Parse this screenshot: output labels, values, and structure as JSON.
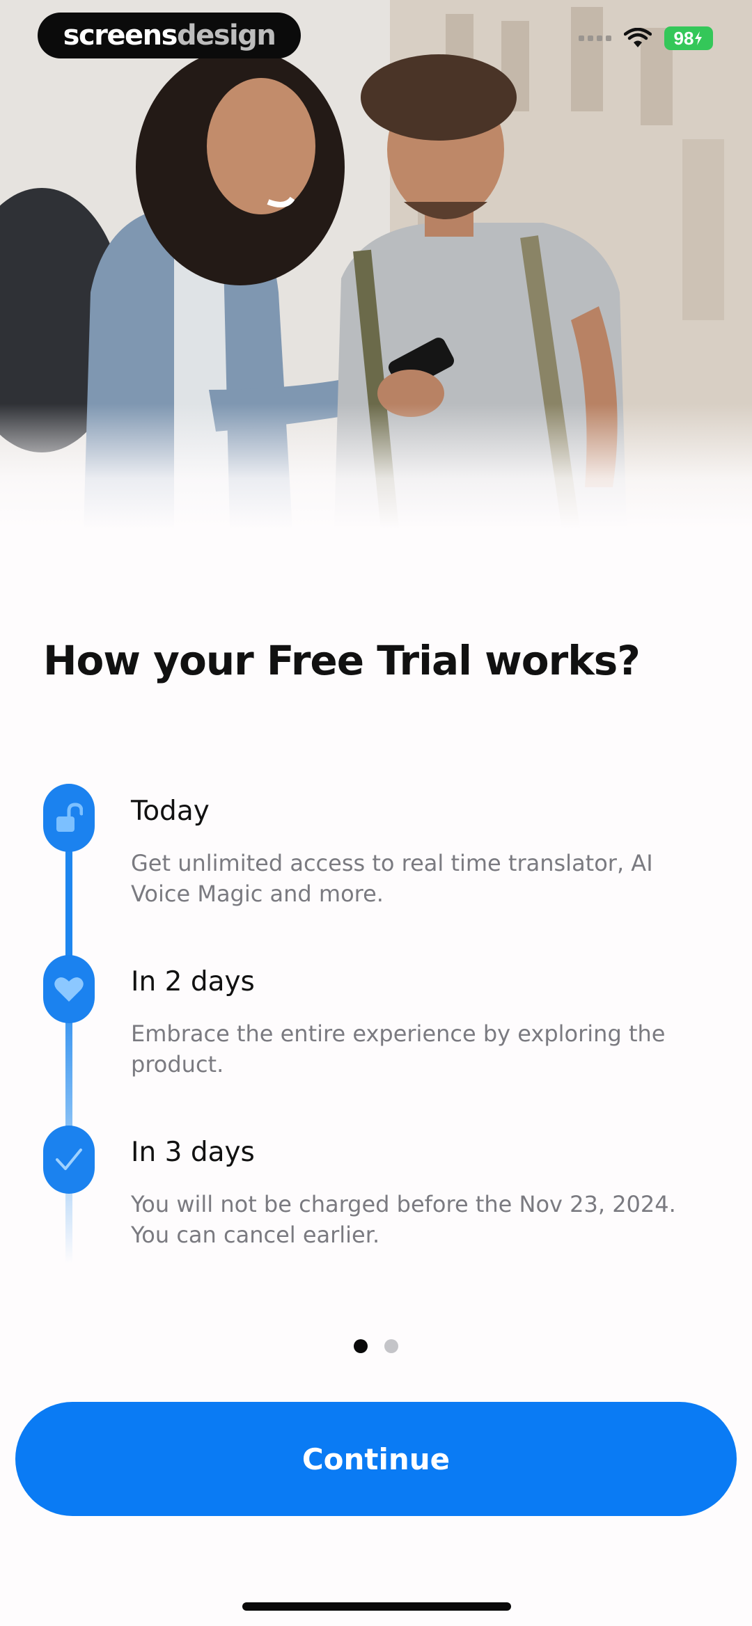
{
  "brand": {
    "bold": "screens",
    "light": "design"
  },
  "status_bar": {
    "battery": "98",
    "wifi_icon": "wifi-icon",
    "charging_icon": "bolt-icon"
  },
  "title": "How your Free Trial works?",
  "timeline": [
    {
      "icon": "unlock-icon",
      "title": "Today",
      "description": "Get unlimited access to real time translator, AI Voice Magic and more."
    },
    {
      "icon": "heart-icon",
      "title": "In 2 days",
      "description": "Embrace the entire experience by exploring the product."
    },
    {
      "icon": "check-icon",
      "title": "In 3 days",
      "description": "You will not be charged before the Nov 23, 2024. You can cancel earlier."
    }
  ],
  "pager": {
    "total": 2,
    "active_index": 0
  },
  "continue_label": "Continue",
  "colors": {
    "accent": "#0a7bf4",
    "timeline": "#1b82ef",
    "title": "#111111",
    "description": "#7a7a80",
    "battery": "#34c759"
  }
}
